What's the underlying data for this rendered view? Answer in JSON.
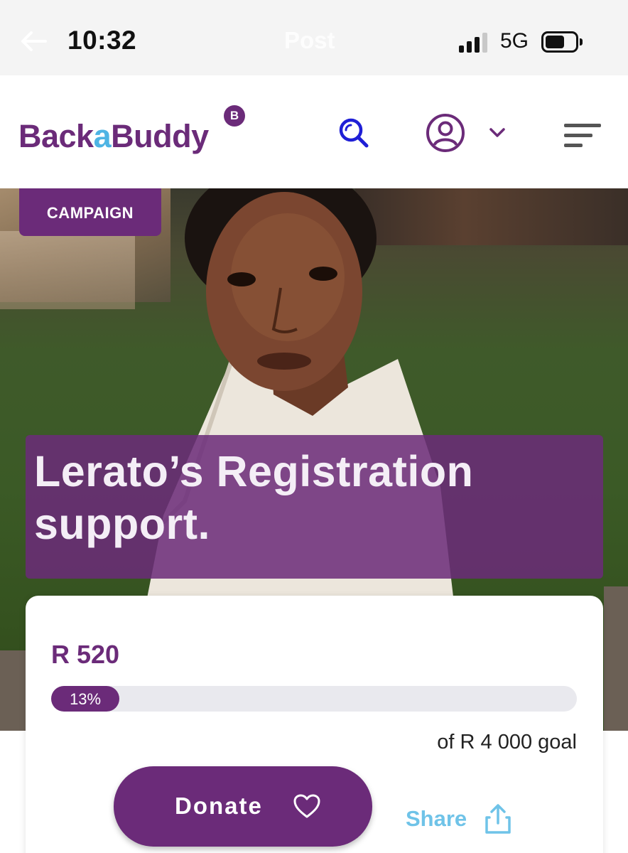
{
  "status_bar": {
    "time": "10:32",
    "center_title": "Post",
    "network": "5G",
    "icons": [
      "back-arrow-icon",
      "signal-icon",
      "battery-icon"
    ]
  },
  "header": {
    "logo": {
      "part1": "Back",
      "part2": "a",
      "part3": "Buddy",
      "badge": "B"
    },
    "icons": [
      "search-icon",
      "user-account-icon",
      "chevron-down-icon",
      "menu-icon"
    ]
  },
  "hero": {
    "tag": "CAMPAIGN",
    "title_line1": "Lerato’s Registration",
    "title_line2": "support."
  },
  "donation": {
    "raised": "R 520",
    "progress_label": "13%",
    "progress_fraction": 0.13,
    "goal": "of R 4 000 goal",
    "donate_label": "Donate",
    "share_label": "Share"
  },
  "colors": {
    "brand_purple": "#6b2b79",
    "brand_blue": "#4eb4e4",
    "search_icon": "#1f1fd6",
    "share_blue": "#6fc3e8"
  }
}
